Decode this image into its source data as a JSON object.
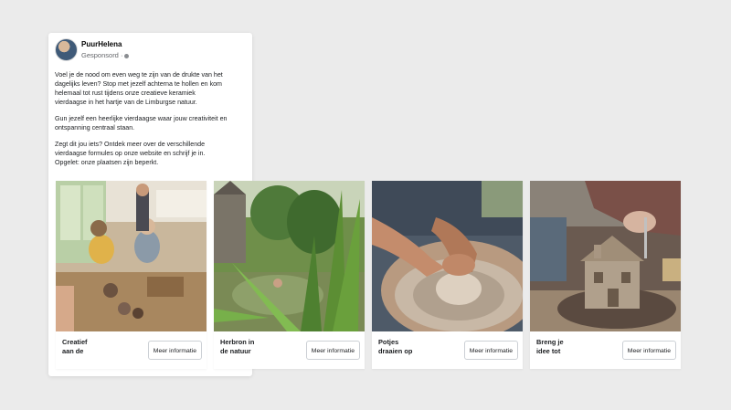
{
  "post": {
    "page_name": "PuurHelena",
    "sponsored": "Gesponsord",
    "paragraphs": [
      "Voel je de nood om even weg te zijn van de drukte van het\ndagelijks leven? Stop met jezelf achterna te hollen en kom\nhelemaal tot rust tijdens onze creatieve keramiek\nvierdaagse in het hartje van de Limburgse natuur.",
      "Gun jezelf een heerlijke vierdaagse waar jouw creativiteit en\nontspanning centraal staan.",
      "Zegt dit jou iets? Ontdek meer over de verschillende\nvierdaagse formules op onze website en schrijf je in.\nOpgelet: onze plaatsen zijn beperkt."
    ]
  },
  "cards": [
    {
      "headline": "Creatief\naan de",
      "cta": "Meer informatie",
      "image": "workshop-table-photo"
    },
    {
      "headline": "Herbron in\nde natuur",
      "cta": "Meer informatie",
      "image": "pond-nature-photo"
    },
    {
      "headline": "Potjes\ndraaien op",
      "cta": "Meer informatie",
      "image": "pottery-wheel-photo"
    },
    {
      "headline": "Breng je\nidee tot",
      "cta": "Meer informatie",
      "image": "clay-house-photo"
    }
  ],
  "colors": {
    "background": "#ebebeb",
    "card": "#ffffff",
    "text": "#1c1e21",
    "muted": "#65676b"
  }
}
